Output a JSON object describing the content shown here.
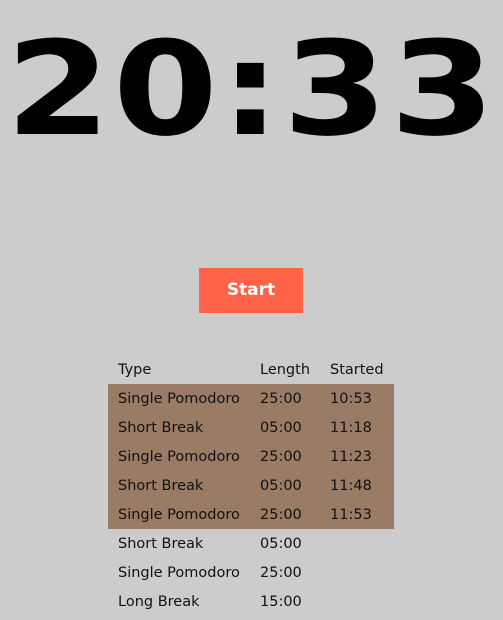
{
  "clock": {
    "time": "20:33"
  },
  "controls": {
    "start_label": "Start"
  },
  "table": {
    "headers": {
      "type": "Type",
      "length": "Length",
      "started": "Started"
    },
    "rows": [
      {
        "type": "Single Pomodoro",
        "length": "25:00",
        "started": "10:53",
        "completed": true
      },
      {
        "type": "Short Break",
        "length": "05:00",
        "started": "11:18",
        "completed": true
      },
      {
        "type": "Single Pomodoro",
        "length": "25:00",
        "started": "11:23",
        "completed": true
      },
      {
        "type": "Short Break",
        "length": "05:00",
        "started": "11:48",
        "completed": true
      },
      {
        "type": "Single Pomodoro",
        "length": "25:00",
        "started": "11:53",
        "completed": true
      },
      {
        "type": "Short Break",
        "length": "05:00",
        "started": "",
        "completed": false
      },
      {
        "type": "Single Pomodoro",
        "length": "25:00",
        "started": "",
        "completed": false
      },
      {
        "type": "Long Break",
        "length": "15:00",
        "started": "",
        "completed": false
      }
    ]
  },
  "colors": {
    "background": "#cccccc",
    "start_button": "#ff6347",
    "completed_row": "#9a7b66"
  }
}
